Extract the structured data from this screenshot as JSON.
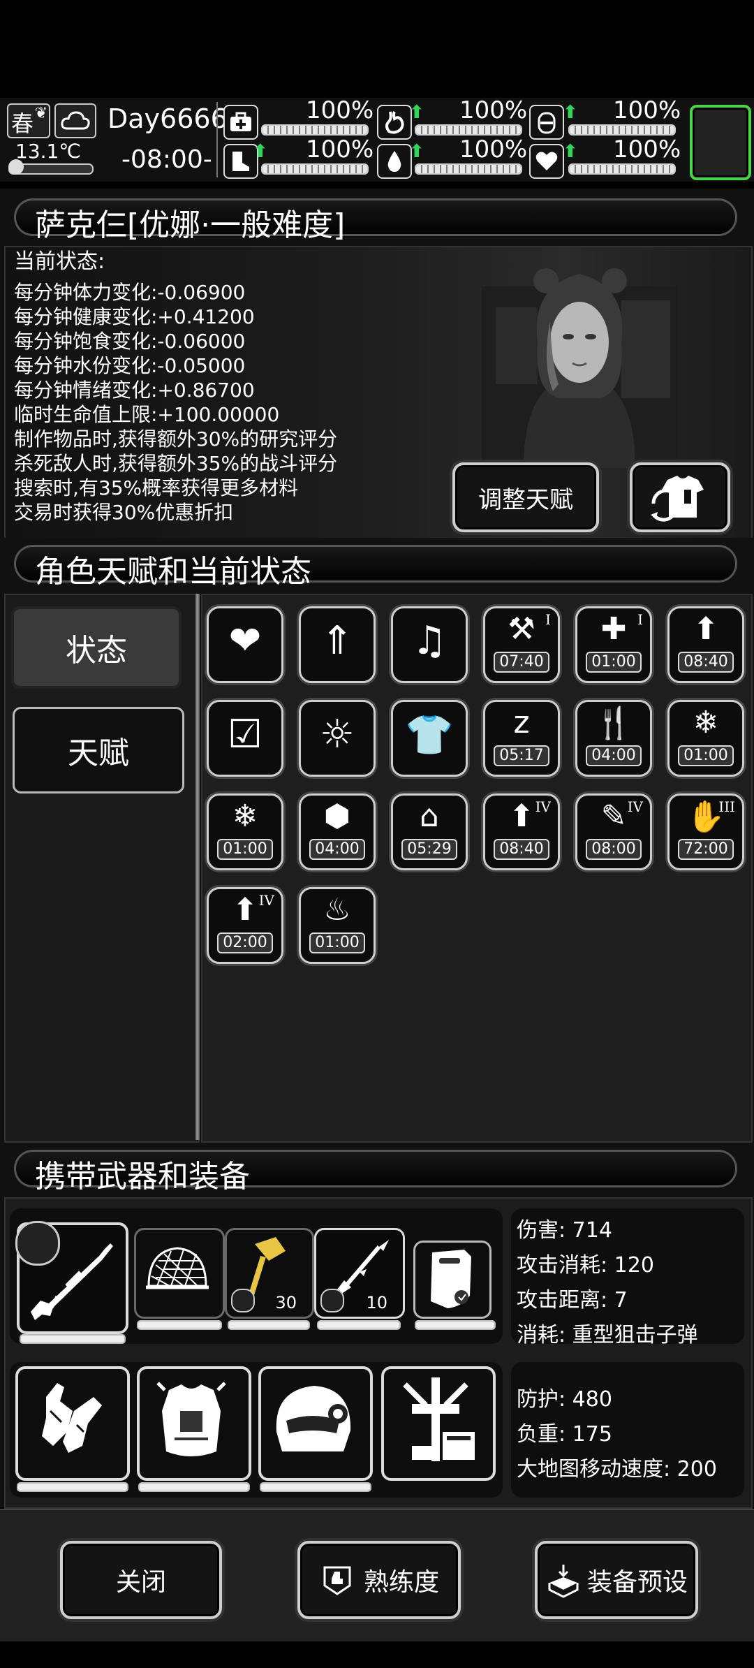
{
  "hud": {
    "season": "春",
    "temperature": "13.1℃",
    "day": "Day6666",
    "time": "-08:00-",
    "stats": [
      {
        "name": "medkit-icon",
        "value": "100%",
        "level": 1.0,
        "up": false
      },
      {
        "name": "stomach-icon",
        "value": "100%",
        "level": 1.0,
        "up": true
      },
      {
        "name": "bladder-icon",
        "value": "100%",
        "level": 1.0,
        "up": true
      },
      {
        "name": "boot-icon",
        "value": "100%",
        "level": 1.0,
        "up": true
      },
      {
        "name": "water-drop-icon",
        "value": "100%",
        "level": 1.0,
        "up": true
      },
      {
        "name": "heart-icon",
        "value": "100%",
        "level": 1.0,
        "up": true
      }
    ]
  },
  "character": {
    "title": "萨克仨[优娜·一般难度]",
    "status_header": "当前状态:",
    "lines": [
      "每分钟体力变化:-0.06900",
      "每分钟健康变化:+0.41200",
      "每分钟饱食变化:-0.06000",
      "每分钟水份变化:-0.05000",
      "每分钟情绪变化:+0.86700",
      "临时生命值上限:+100.00000",
      "制作物品时,获得额外30%的研究评分",
      "杀死敌人时,获得额外35%的战斗评分",
      "搜索时,有35%概率获得更多材料",
      "交易时获得30%优惠折扣"
    ],
    "adjust_talent_label": "调整天赋"
  },
  "talents": {
    "title": "角色天赋和当前状态",
    "tabs": [
      "状态",
      "天赋"
    ],
    "slots": [
      {
        "icon": "heart-icon",
        "timer": "",
        "roman": ""
      },
      {
        "icon": "stomach-up-icon",
        "timer": "",
        "roman": ""
      },
      {
        "icon": "music-heart-icon",
        "timer": "",
        "roman": ""
      },
      {
        "icon": "toolbox-up-icon",
        "timer": "07:40",
        "roman": "I"
      },
      {
        "icon": "medical-pill-icon",
        "timer": "01:00",
        "roman": "I"
      },
      {
        "icon": "food-up-icon",
        "timer": "08:40",
        "roman": ""
      },
      {
        "icon": "clipboard-pill-icon",
        "timer": "",
        "roman": ""
      },
      {
        "icon": "alarm-person-icon",
        "timer": "",
        "roman": ""
      },
      {
        "icon": "shirt-icon",
        "timer": "",
        "roman": ""
      },
      {
        "icon": "sleep-icon",
        "timer": "05:17",
        "roman": ""
      },
      {
        "icon": "meal-icon",
        "timer": "04:00",
        "roman": ""
      },
      {
        "icon": "cold-food-icon",
        "timer": "01:00",
        "roman": ""
      },
      {
        "icon": "snow-box-icon",
        "timer": "01:00",
        "roman": ""
      },
      {
        "icon": "carrot-icon",
        "timer": "04:00",
        "roman": ""
      },
      {
        "icon": "search-house-icon",
        "timer": "05:29",
        "roman": ""
      },
      {
        "icon": "bottle-up-icon",
        "timer": "08:40",
        "roman": "IV"
      },
      {
        "icon": "pencil-up-icon",
        "timer": "08:00",
        "roman": "IV"
      },
      {
        "icon": "hand-icon",
        "timer": "72:00",
        "roman": "III"
      },
      {
        "icon": "build-up-icon",
        "timer": "02:00",
        "roman": "IV"
      },
      {
        "icon": "heat-icon",
        "timer": "01:00",
        "roman": ""
      }
    ]
  },
  "equipment": {
    "title": "携带武器和装备",
    "weapon_slots": [
      {
        "icon": "sniper-rifle-icon",
        "count": ""
      },
      {
        "icon": "net-trap-icon",
        "count": ""
      },
      {
        "icon": "hammer-icon",
        "count": "30"
      },
      {
        "icon": "spear-icon",
        "count": "10"
      },
      {
        "icon": "riot-shield-icon",
        "count": ""
      }
    ],
    "weapon_info": [
      "伤害: 714",
      "攻击消耗: 120",
      "攻击距离: 7",
      "消耗: 重型狙击子弹"
    ],
    "armor_slots": [
      {
        "icon": "gloves-icon"
      },
      {
        "icon": "body-armor-icon"
      },
      {
        "icon": "helmet-icon"
      },
      {
        "icon": "backpack-frame-icon"
      }
    ],
    "armor_info": [
      "防护: 480",
      "负重: 175",
      "大地图移动速度: 200"
    ]
  },
  "buttons": {
    "close": "关闭",
    "proficiency": "熟练度",
    "preset": "装备预设"
  }
}
